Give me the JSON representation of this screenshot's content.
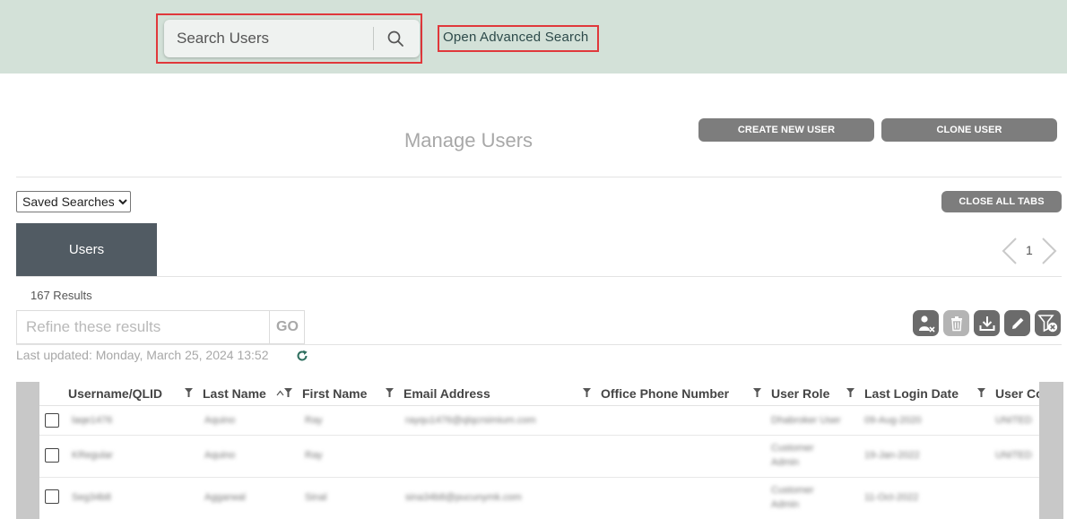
{
  "header": {
    "search_placeholder": "Search Users",
    "search_icon": "search-icon",
    "advanced_search_link": "Open Advanced Search"
  },
  "page": {
    "title": "Manage Users",
    "create_button": "CREATE NEW USER",
    "clone_button": "CLONE USER",
    "close_tabs_button": "CLOSE ALL TABS",
    "saved_searches_label": "Saved Searches"
  },
  "tabs": [
    {
      "label": "Users",
      "active": true
    }
  ],
  "pager": {
    "current_page": "1"
  },
  "results": {
    "count_text": "167 Results",
    "refine_placeholder": "Refine these results",
    "go_label": "GO",
    "last_updated": "Last updated: Monday, March 25, 2024 13:52"
  },
  "toolbar_icons": [
    "remove-user-icon",
    "trash-icon",
    "download-icon",
    "edit-pencil-icon",
    "clear-filter-icon"
  ],
  "table": {
    "columns": [
      "Username/QLID",
      "Last Name",
      "First Name",
      "Email Address",
      "Office Phone Number",
      "User Role",
      "Last Login Date",
      "User Co"
    ],
    "sorted_column": "Last Name",
    "rows": [
      [
        "laqe1476",
        "Aquino",
        "Ray",
        "rayqu1476@qlqcrsimium.com",
        "",
        "Dhabroker User",
        "09-Aug-2020",
        "UNITED"
      ],
      [
        "KRegular",
        "Aquino",
        "Ray",
        "",
        "",
        "Customer Admin",
        "19-Jan-2022",
        "UNITED"
      ],
      [
        "Seg34b8",
        "Aggarwal",
        "Sinal",
        "sina34b8@pucunymk.com",
        "",
        "Customer Admin",
        "11-Oct-2022",
        ""
      ]
    ]
  },
  "colors": {
    "topbar": "#d3e1d8",
    "tab_active": "#515b63",
    "button": "#7d7d7d",
    "highlight": "#e0383b",
    "refresh": "#2e6e5e"
  }
}
